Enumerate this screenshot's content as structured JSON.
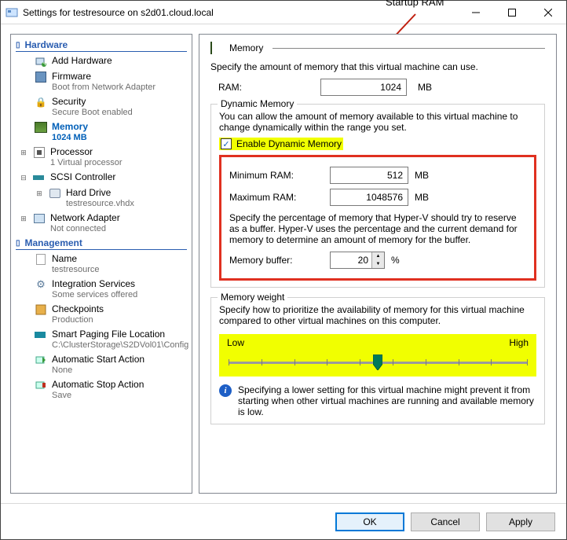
{
  "window": {
    "title": "Settings for testresource on s2d01.cloud.local"
  },
  "annotation": {
    "label": "Startup RAM"
  },
  "sections": {
    "hardware": "Hardware",
    "management": "Management"
  },
  "tree": {
    "addHardware": "Add Hardware",
    "firmware": {
      "label": "Firmware",
      "sub": "Boot from Network Adapter"
    },
    "security": {
      "label": "Security",
      "sub": "Secure Boot enabled"
    },
    "memory": {
      "label": "Memory",
      "sub": "1024 MB"
    },
    "processor": {
      "label": "Processor",
      "sub": "1 Virtual processor"
    },
    "scsi": {
      "label": "SCSI Controller"
    },
    "hardDrive": {
      "label": "Hard Drive",
      "sub": "testresource.vhdx"
    },
    "netAdapter": {
      "label": "Network Adapter",
      "sub": "Not connected"
    },
    "name": {
      "label": "Name",
      "sub": "testresource"
    },
    "integration": {
      "label": "Integration Services",
      "sub": "Some services offered"
    },
    "checkpoints": {
      "label": "Checkpoints",
      "sub": "Production"
    },
    "smartPaging": {
      "label": "Smart Paging File Location",
      "sub": "C:\\ClusterStorage\\S2DVol01\\Config"
    },
    "autoStart": {
      "label": "Automatic Start Action",
      "sub": "None"
    },
    "autoStop": {
      "label": "Automatic Stop Action",
      "sub": "Save"
    }
  },
  "memory": {
    "header": "Memory",
    "intro": "Specify the amount of memory that this virtual machine can use.",
    "ramLabel": "RAM:",
    "ramValue": "1024",
    "ramUnit": "MB",
    "dynamic": {
      "legend": "Dynamic Memory",
      "intro": "You can allow the amount of memory available to this virtual machine to change dynamically within the range you set.",
      "enableLabel": "Enable Dynamic Memory",
      "minLabel": "Minimum RAM:",
      "minValue": "512",
      "minUnit": "MB",
      "maxLabel": "Maximum RAM:",
      "maxValue": "1048576",
      "maxUnit": "MB",
      "bufferIntro": "Specify the percentage of memory that Hyper-V should try to reserve as a buffer. Hyper-V uses the percentage and the current demand for memory to determine an amount of memory for the buffer.",
      "bufferLabel": "Memory buffer:",
      "bufferValue": "20",
      "bufferUnit": "%"
    },
    "weight": {
      "legend": "Memory weight",
      "intro": "Specify how to prioritize the availability of memory for this virtual machine compared to other virtual machines on this computer.",
      "low": "Low",
      "high": "High",
      "info": "Specifying a lower setting for this virtual machine might prevent it from starting when other virtual machines are running and available memory is low."
    }
  },
  "buttons": {
    "ok": "OK",
    "cancel": "Cancel",
    "apply": "Apply"
  }
}
